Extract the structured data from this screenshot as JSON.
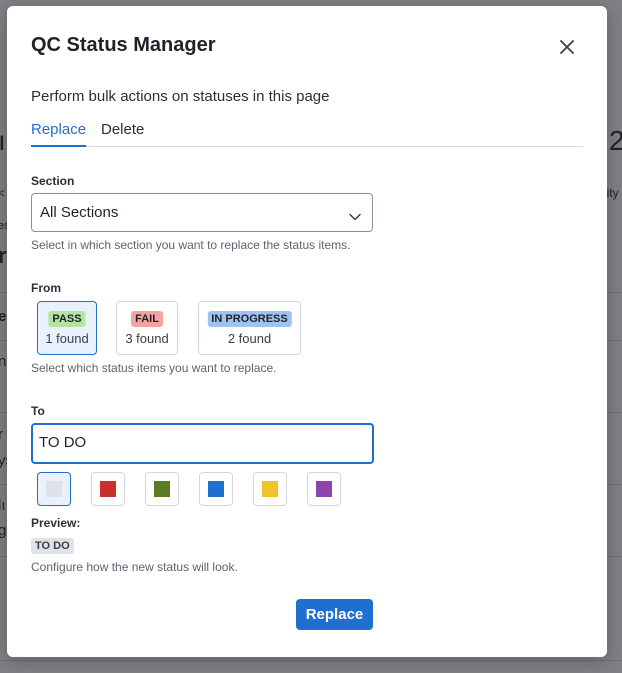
{
  "background": {
    "fragments": [
      "ı",
      "2",
      "<",
      "lity",
      "es",
      "r",
      "e",
      "n",
      "r",
      "ys",
      "lı",
      "g"
    ]
  },
  "modal": {
    "title": "QC Status Manager",
    "close_icon": "close-icon",
    "subtitle": "Perform bulk actions on statuses in this page",
    "tabs": [
      {
        "label": "Replace",
        "active": true
      },
      {
        "label": "Delete",
        "active": false
      }
    ],
    "section": {
      "label": "Section",
      "value": "All Sections",
      "helper": "Select in which section you want to replace the status items."
    },
    "from": {
      "label": "From",
      "items": [
        {
          "badge": "PASS",
          "count": "1 found",
          "color": "#b5e3a0",
          "selected": true
        },
        {
          "badge": "FAIL",
          "count": "3 found",
          "color": "#f4a3a0",
          "selected": false
        },
        {
          "badge": "IN PROGRESS",
          "count": "2 found",
          "color": "#9fc3f0",
          "selected": false
        }
      ],
      "helper": "Select which status items you want to replace."
    },
    "to": {
      "label": "To",
      "value": "TO DO",
      "colors": [
        "#dfe3e8",
        "#c9302c",
        "#5a7d24",
        "#1f6fd1",
        "#f2c12e",
        "#8e44ad"
      ],
      "selected_color_index": 0
    },
    "preview": {
      "label": "Preview:",
      "badge": "TO DO",
      "badge_color": "#dfe3e8",
      "helper": "Configure how the new status will look."
    },
    "submit_label": "Replace"
  },
  "colors": {
    "accent": "#1f6fd1"
  }
}
